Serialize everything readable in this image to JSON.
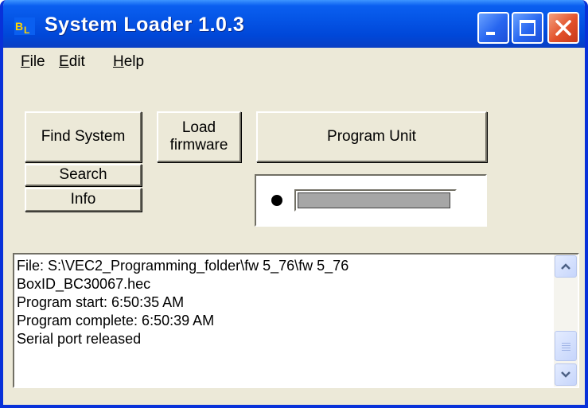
{
  "window": {
    "title": "System Loader 1.0.3",
    "accent_color": "#0a5ff0",
    "close_color": "#e2502a",
    "icon": "bl-app-icon"
  },
  "menu": {
    "items": [
      {
        "label": "File",
        "mnemonic": "F",
        "rest": "ile"
      },
      {
        "label": "Edit",
        "mnemonic": "E",
        "rest": "dit"
      },
      {
        "label": "Help",
        "mnemonic": "H",
        "rest": "elp"
      }
    ]
  },
  "buttons": {
    "find_system": "Find System",
    "load_firmware_line1": "Load",
    "load_firmware_line2": "firmware",
    "program_unit": "Program Unit",
    "search": "Search",
    "info": "Info"
  },
  "progress": {
    "status_indicator": "black-dot",
    "value": 0.98
  },
  "log": {
    "lines": [
      "File: S:\\VEC2_Programming_folder\\fw 5_76\\fw 5_76",
      "BoxID_BC30067.hec",
      "Program start: 6:50:35 AM",
      "Program complete: 6:50:39 AM",
      "Serial port released"
    ],
    "scroll_position": 0.86
  }
}
